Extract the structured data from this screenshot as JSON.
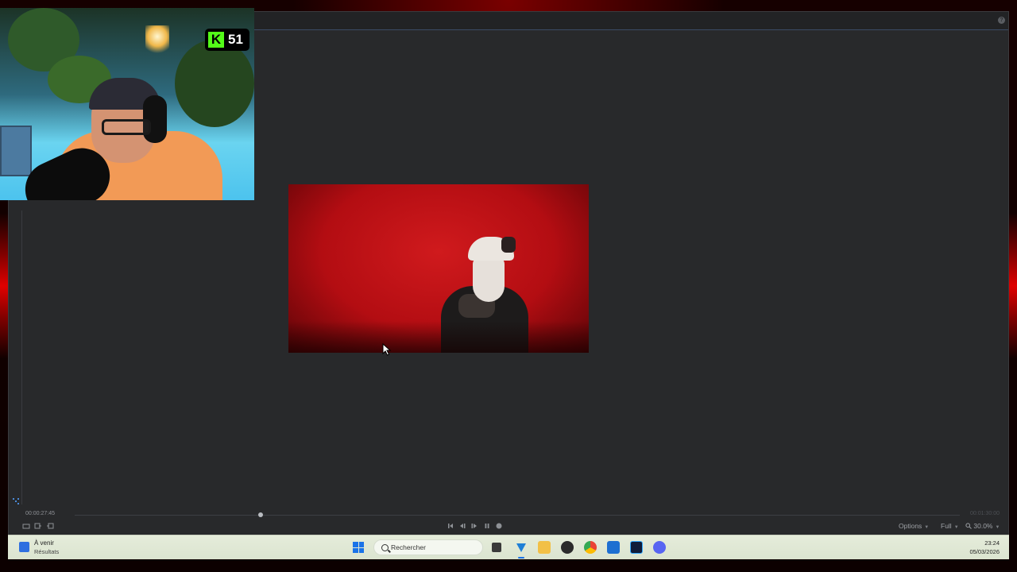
{
  "overlay": {
    "badge_count": "51",
    "badge_letter": "K",
    "badge_color": "#53fc18"
  },
  "player": {
    "current_time": "00:00:27:45",
    "total_time": "00:01:30:00",
    "progress_fraction": 0.21,
    "options_label": "Options",
    "quality_label": "Full",
    "zoom_label": "30.0%"
  },
  "taskbar": {
    "weather_title": "À venir",
    "weather_subtitle": "Résultats",
    "search_placeholder": "Rechercher",
    "time": "23:24",
    "date": "05/03/2026",
    "apps": [
      "task-view-icon",
      "vegas-icon",
      "file-explorer-icon",
      "media-icon",
      "chrome-icon",
      "kick-icon",
      "photoshop-icon",
      "discord-icon"
    ]
  },
  "colors": {
    "frame_glow": "#e00000",
    "app_background": "#28292b",
    "taskbar": "#e5ecda",
    "accent": "#1a73e8"
  }
}
